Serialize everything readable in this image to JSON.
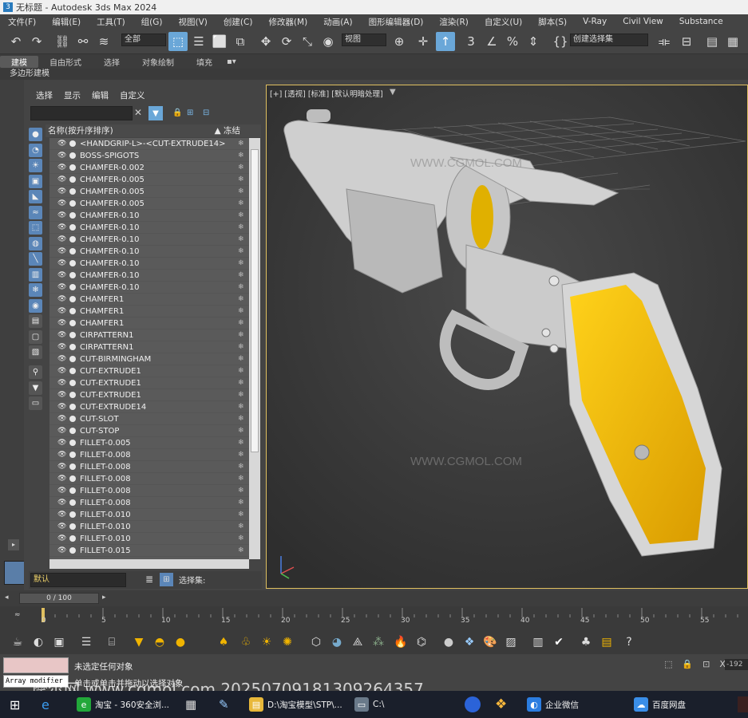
{
  "window": {
    "title": "无标题 - Autodesk 3ds Max 2024"
  },
  "menu": [
    "文件(F)",
    "编辑(E)",
    "工具(T)",
    "组(G)",
    "视图(V)",
    "创建(C)",
    "修改器(M)",
    "动画(A)",
    "图形编辑器(D)",
    "渲染(R)",
    "自定义(U)",
    "脚本(S)",
    "V-Ray",
    "Civil View",
    "Substance"
  ],
  "toolbar": {
    "filter_value": "全部",
    "refcoord_value": "视图",
    "named_selection_placeholder": "创建选择集"
  },
  "ribbon": {
    "tabs": [
      "建模",
      "自由形式",
      "选择",
      "对象绘制",
      "填充"
    ],
    "active": "建模",
    "sub_label": "多边形建模"
  },
  "explorer": {
    "menu": [
      "选择",
      "显示",
      "编辑",
      "自定义"
    ],
    "header_name": "名称(按升序排序)",
    "header_freeze": "▲ 冻结",
    "layer_value": "默认",
    "selection_set_label": "选择集:",
    "items": [
      "<HANDGRIP-L>-<CUT-EXTRUDE14>",
      "BOSS-SPIGOTS",
      "CHAMFER-0.002",
      "CHAMFER-0.005",
      "CHAMFER-0.005",
      "CHAMFER-0.005",
      "CHAMFER-0.10",
      "CHAMFER-0.10",
      "CHAMFER-0.10",
      "CHAMFER-0.10",
      "CHAMFER-0.10",
      "CHAMFER-0.10",
      "CHAMFER-0.10",
      "CHAMFER1",
      "CHAMFER1",
      "CHAMFER1",
      "CIRPATTERN1",
      "CIRPATTERN1",
      "CUT-BIRMINGHAM",
      "CUT-EXTRUDE1",
      "CUT-EXTRUDE1",
      "CUT-EXTRUDE1",
      "CUT-EXTRUDE14",
      "CUT-SLOT",
      "CUT-STOP",
      "FILLET-0.005",
      "FILLET-0.008",
      "FILLET-0.008",
      "FILLET-0.008",
      "FILLET-0.008",
      "FILLET-0.008",
      "FILLET-0.010",
      "FILLET-0.010",
      "FILLET-0.010",
      "FILLET-0.015"
    ]
  },
  "viewport": {
    "label": "[+] [透视] [标准] [默认明暗处理]",
    "watermark": "WWW.CGMOL.COM"
  },
  "timeline": {
    "frame_display": "0 / 100",
    "ticks": [
      "0",
      "5",
      "10",
      "15",
      "20",
      "25",
      "30",
      "35",
      "40",
      "45",
      "50",
      "55"
    ]
  },
  "status": {
    "script_text": "Array modifier",
    "line1": "未选定任何对象",
    "line2": "单击或单击并拖动以选择对象",
    "coord_readout": "-192"
  },
  "overlay_watermark": "摩尔网 www.cgmol.com 20250709181309264357",
  "taskbar": [
    {
      "label": "淘宝 - 360安全浏...",
      "color": "#22a83a",
      "icon": "e"
    },
    {
      "label": "D:\\淘宝模型\\STP\\...",
      "color": "#e8b83a",
      "icon": "▤"
    },
    {
      "label": "C:\\",
      "color": "#6a7a8a",
      "icon": "▭"
    },
    {
      "label": "企业微信",
      "color": "#2b7de0",
      "icon": "◐"
    },
    {
      "label": "百度网盘",
      "color": "#3a8ee8",
      "icon": "☁"
    }
  ],
  "colors": {
    "accent": "#6aa7d8",
    "grip": "#f2b800",
    "viewport_border": "#e0c060"
  }
}
